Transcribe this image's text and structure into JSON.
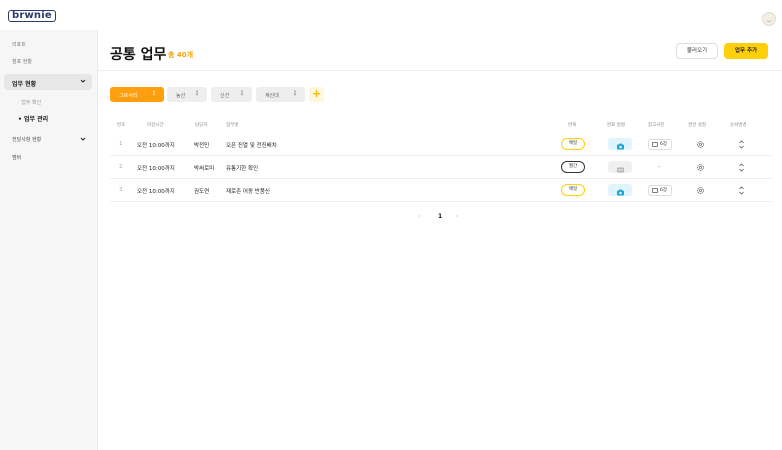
{
  "app": {
    "logo_text": "brwnie"
  },
  "sidebar": {
    "items": [
      {
        "label": "리포트"
      },
      {
        "label": "점포 현황"
      }
    ],
    "group_task": {
      "label": "업무 현황",
      "sub": [
        {
          "label": "업무 확인"
        },
        {
          "label": "업무 관리"
        }
      ]
    },
    "group_notice": {
      "label": "전달사항 현황"
    },
    "member": {
      "label": "멤버"
    }
  },
  "header": {
    "title": "공통 업무",
    "total": "총 40개",
    "load_button": "불러오기",
    "add_button": "업무 추가"
  },
  "tabs": [
    {
      "label": "그로서리"
    },
    {
      "label": "농산"
    },
    {
      "label": "신선"
    },
    {
      "label": "계산대"
    }
  ],
  "table": {
    "headers": {
      "no": "번호",
      "deadline": "마감시간",
      "assignee": "담당자",
      "task": "업무명",
      "repeat": "반복",
      "method": "완료 방법",
      "refimg": "참고사진",
      "perm": "권한 설정",
      "order": "순서변경"
    },
    "rows": [
      {
        "no": "1",
        "deadline": "오전 10:00까지",
        "assignee": "박전민",
        "task": "오픈 진열 및 전진배치",
        "repeat": "매일",
        "repeat_type": "daily",
        "method": "camera",
        "refimg": "6장"
      },
      {
        "no": "2",
        "deadline": "오전 10:00까지",
        "assignee": "박써로미",
        "task": "유통기한 확인",
        "repeat": "월간",
        "repeat_type": "weekly",
        "method": "document",
        "refimg": "-"
      },
      {
        "no": "3",
        "deadline": "오전 10:00까지",
        "assignee": "권도연",
        "task": "재로존 어동 반품신",
        "repeat": "매일",
        "repeat_type": "daily",
        "method": "camera",
        "refimg": "6장"
      }
    ]
  },
  "pager": {
    "prev": "‹",
    "current": "1",
    "next": "›"
  },
  "colors": {
    "accent": "#ff9f0f",
    "primary_button": "#ffcf0a",
    "camera_bg": "#dff4fb",
    "camera_icon": "#1aa6d6"
  }
}
